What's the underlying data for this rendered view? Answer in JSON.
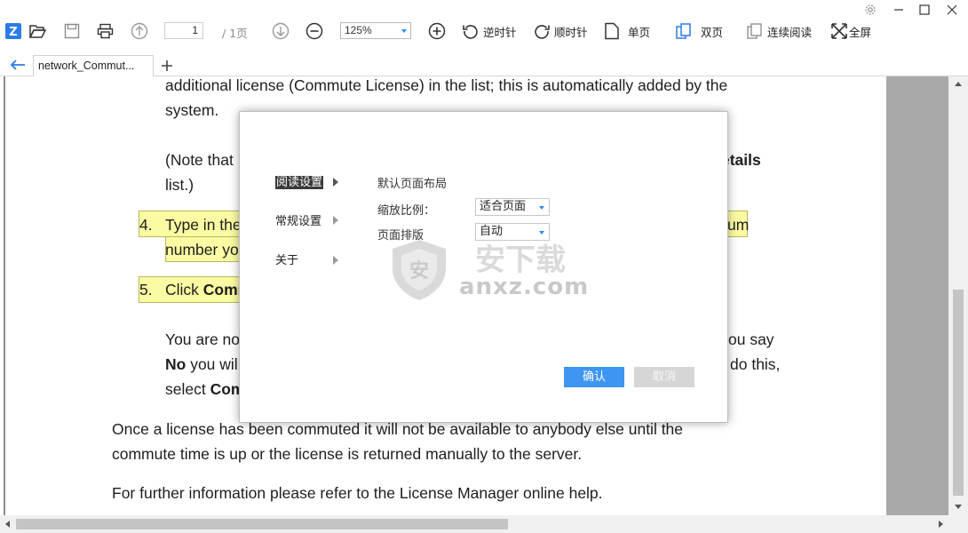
{
  "toolbar": {
    "page_current": "1",
    "page_total": "/ 1页",
    "zoom": "125%",
    "rotate_ccw": "逆时针",
    "rotate_cw": "顺时针",
    "single_page": "单页",
    "double_page": "双页",
    "continuous": "连续阅读",
    "fullscreen": "全屏"
  },
  "tab": {
    "title": "network_Commut..."
  },
  "document": {
    "line1": "additional license (Commute License) in the list; this is automatically added by the",
    "line2": "system.",
    "line3": "(Note that",
    "line3_right": "etails",
    "line4": "list.)",
    "item4_num": "4.",
    "item4_text": "Type in the",
    "item4_right": "um",
    "item4_line2": "number yo",
    "item5_num": "5.",
    "item5_text_prefix": "Click ",
    "item5_text_bold": "Comr",
    "para_a1": "You are no",
    "para_a1_right": "ou say",
    "para_a2_bold": "No",
    "para_a2": " you wil",
    "para_a2_right": "do this,",
    "para_a3": "select ",
    "para_a3_bold": "Com",
    "para_b1": "Once a license has been commuted it will not be available to anybody else until the",
    "para_b2": "commute time is up or the license is returned manually to the server.",
    "para_c": "For further information please refer to the License Manager online help."
  },
  "dialog": {
    "nav": [
      "阅读设置",
      "常规设置",
      "关于"
    ],
    "section_title": "默认页面布局",
    "zoom_label": "缩放比例：",
    "zoom_value": "适合页面",
    "layout_label": "页面排版",
    "layout_value": "自动",
    "ok": "确认",
    "cancel": "取消"
  },
  "watermark": {
    "text": "anxz.com",
    "glyphs": "安下载"
  },
  "colors": {
    "accent": "#3e96f0",
    "highlight": "#fbfba3",
    "gutter": "#a9a9a9"
  },
  "icons": [
    "app-logo-icon",
    "open-folder-icon",
    "save-icon",
    "print-icon",
    "prev-page-icon",
    "next-page-icon",
    "zoom-out-icon",
    "zoom-in-icon",
    "rotate-ccw-icon",
    "rotate-cw-icon",
    "single-page-icon",
    "double-page-icon",
    "continuous-icon",
    "fullscreen-icon",
    "settings-icon",
    "minimize-icon",
    "maximize-icon",
    "close-icon",
    "back-arrow-icon",
    "add-tab-icon"
  ]
}
